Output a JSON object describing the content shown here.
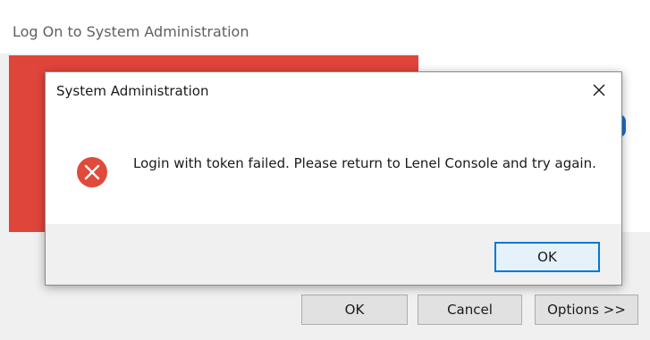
{
  "background_window": {
    "title": "Log On to System Administration",
    "buttons": {
      "ok_label": "OK",
      "cancel_label": "Cancel",
      "options_label": "Options >>"
    },
    "banner_color": "#e0453a"
  },
  "dialog": {
    "title": "System Administration",
    "close_icon": "close-icon",
    "error_icon": "error-icon",
    "error_color": "#e04a3a",
    "message": "Login with token failed. Please return to Lenel Console and try again.",
    "ok_label": "OK",
    "accent_color": "#0078d7"
  }
}
